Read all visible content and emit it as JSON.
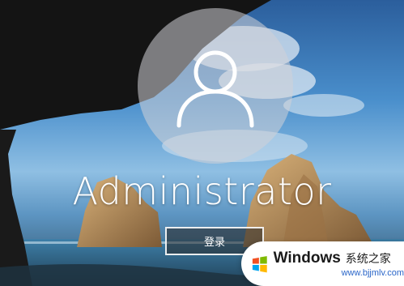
{
  "lock_screen": {
    "username": "Administrator",
    "signin_label": "登录"
  },
  "watermark": {
    "brand": "Windows",
    "subtitle": "系统之家",
    "url": "www.bjjmlv.com"
  },
  "icons": {
    "avatar": "user-avatar-icon",
    "logo": "windows-logo-icon"
  },
  "colors": {
    "signin_border": "#ffffff",
    "badge_background": "#ffffff",
    "url_color": "#2a66c9"
  }
}
